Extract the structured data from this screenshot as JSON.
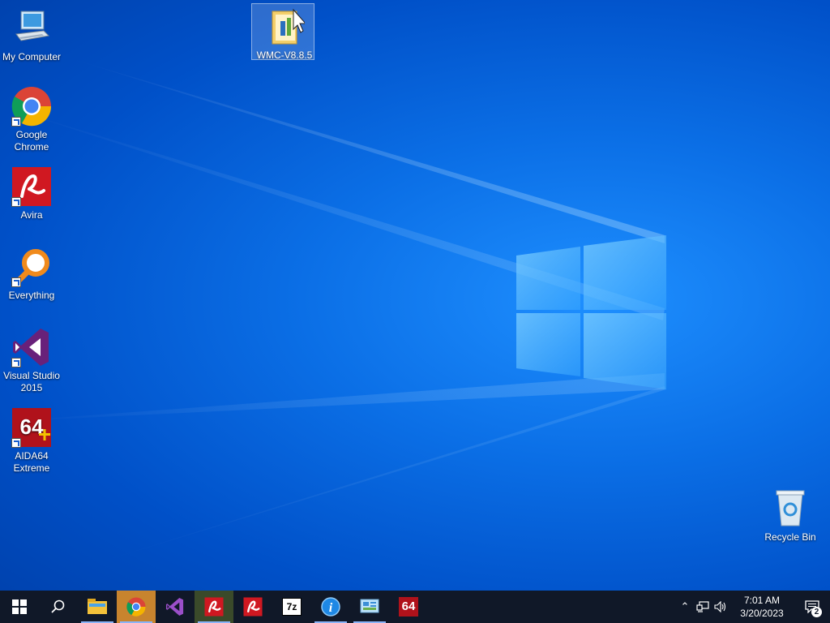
{
  "desktop": {
    "icons": [
      {
        "label": "My Computer"
      },
      {
        "label": "Google Chrome"
      },
      {
        "label": "Avira"
      },
      {
        "label": "Everything"
      },
      {
        "label": "Visual Studio 2015"
      },
      {
        "label": "AIDA64 Extreme"
      },
      {
        "label": "WMC-V8.8.5"
      },
      {
        "label": "Recycle Bin"
      }
    ]
  },
  "taskbar": {
    "apps": [
      {
        "icon": "start-icon"
      },
      {
        "icon": "search-icon"
      },
      {
        "icon": "file-explorer-icon"
      },
      {
        "icon": "chrome-icon"
      },
      {
        "icon": "visual-studio-icon"
      },
      {
        "icon": "avira-icon"
      },
      {
        "icon": "avira-icon"
      },
      {
        "icon": "7zip-icon",
        "text": "7z"
      },
      {
        "icon": "info-app-icon"
      },
      {
        "icon": "control-panel-icon"
      },
      {
        "icon": "aida64-icon",
        "text": "64"
      }
    ],
    "tray": {
      "time": "7:01 AM",
      "date": "3/20/2023",
      "notification_count": "2"
    }
  },
  "colors": {
    "taskbar_bg": "#101828",
    "desktop_accent": "#0b6fe6"
  }
}
